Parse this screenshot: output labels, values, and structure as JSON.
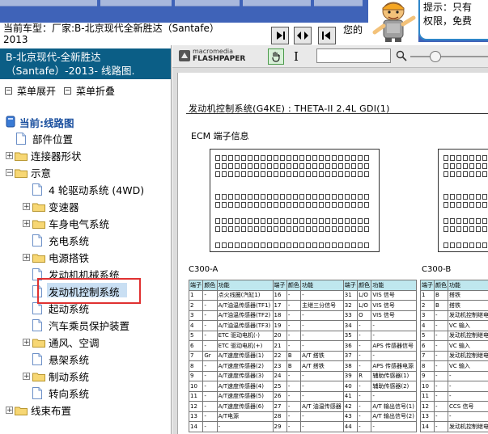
{
  "banner": {
    "tip_line1": "提示：只有",
    "tip_line2": "权限，免费"
  },
  "info": {
    "car_label": "当前车型：",
    "car_factory": "厂家:B-北京现代全新胜达（Santafe）",
    "car_year": "2013",
    "doc_title_partial": "您的"
  },
  "nav": {
    "buttons": [
      "▸|",
      "|◂▸|",
      "|◂"
    ]
  },
  "sidebar": {
    "header_line1": "B-北京现代-全新胜达",
    "header_line2": "（Santafe）-2013- 线路图.",
    "expand_label": "菜单展开",
    "collapse_label": "菜单折叠",
    "root_label": "当前:线路图",
    "items": [
      {
        "label": "部件位置",
        "type": "page",
        "level": 1
      },
      {
        "label": "连接器形状",
        "type": "folder",
        "level": 0,
        "toggle": "+"
      },
      {
        "label": "示意",
        "type": "folder",
        "level": 0,
        "toggle": "−"
      },
      {
        "label": "4 轮驱动系统 (4WD)",
        "type": "page",
        "level": 2
      },
      {
        "label": "变速器",
        "type": "folder",
        "level": 1,
        "toggle": "+"
      },
      {
        "label": "车身电气系统",
        "type": "folder",
        "level": 1,
        "toggle": "+"
      },
      {
        "label": "充电系统",
        "type": "page",
        "level": 2
      },
      {
        "label": "电源搭铁",
        "type": "folder",
        "level": 1,
        "toggle": "+"
      },
      {
        "label": "发动机机械系统",
        "type": "page",
        "level": 2
      },
      {
        "label": "发动机控制系统",
        "type": "page",
        "level": 2,
        "selected": true
      },
      {
        "label": "起动系统",
        "type": "page",
        "level": 2
      },
      {
        "label": "汽车乘员保护装置",
        "type": "page",
        "level": 2
      },
      {
        "label": "通风、空调",
        "type": "folder",
        "level": 1,
        "toggle": "+"
      },
      {
        "label": "悬架系统",
        "type": "page",
        "level": 2
      },
      {
        "label": "制动系统",
        "type": "folder",
        "level": 1,
        "toggle": "+"
      },
      {
        "label": "转向系统",
        "type": "page",
        "level": 2
      },
      {
        "label": "线束布置",
        "type": "folder",
        "level": 0,
        "toggle": "+"
      }
    ]
  },
  "viewer": {
    "brand_top": "macromedia",
    "brand_bottom": "FLASHPAPER",
    "search_value": "",
    "doc_heading": "发动机控制系统(G4KE) : THETA-II 2.4L GDI(1)",
    "doc_subheading": "ECM 端子信息",
    "connector_a_label": "C300-A",
    "connector_b_label": "C300-B",
    "table_a_header": [
      "端子",
      "颜色",
      "功能",
      "端子",
      "颜色",
      "功能",
      "端子",
      "颜色",
      "功能"
    ],
    "table_b_header": [
      "端子",
      "颜色",
      "功能"
    ],
    "table_a_rows": [
      [
        "1",
        "-",
        "点火线圈(汽缸1)",
        "16",
        "-",
        "-",
        "31",
        "L/O",
        "VIS 信号"
      ],
      [
        "2",
        "-",
        "A/T油温传感器(TF1)",
        "17",
        "-",
        "主继三分信号",
        "32",
        "L/O",
        "VIS 信号"
      ],
      [
        "3",
        "-",
        "A/T油温传感器(TF2)",
        "18",
        "-",
        "-",
        "33",
        "O",
        "VIS 信号"
      ],
      [
        "4",
        "-",
        "A/T油温传感器(TF3)",
        "19",
        "-",
        "-",
        "34",
        "-",
        "-"
      ],
      [
        "5",
        "-",
        "ETC 驱动电机(-)",
        "20",
        "-",
        "-",
        "35",
        "-",
        "-"
      ],
      [
        "6",
        "-",
        "ETC 驱动电机(+)",
        "21",
        "-",
        "-",
        "36",
        "-",
        "APS 传感器信号"
      ],
      [
        "7",
        "Gr",
        "A/T速度传感器(1)",
        "22",
        "B",
        "A/T 搭铁",
        "37",
        "-",
        "-"
      ],
      [
        "8",
        "-",
        "A/T速度传感器(2)",
        "23",
        "B",
        "A/T 搭铁",
        "38",
        "-",
        "APS 传感器电源"
      ],
      [
        "9",
        "-",
        "A/T速度传感器(3)",
        "24",
        "-",
        "-",
        "39",
        "R",
        "辅助传感器(1)"
      ],
      [
        "10",
        "-",
        "A/T速度传感器(4)",
        "25",
        "-",
        "-",
        "40",
        "-",
        "辅助传感器(2)"
      ],
      [
        "11",
        "-",
        "A/T速度传感器(5)",
        "26",
        "-",
        "-",
        "41",
        "-",
        "-"
      ],
      [
        "12",
        "-",
        "A/T速度传感器(6)",
        "27",
        "-",
        "A/T 油温传感器",
        "42",
        "-",
        "A/T 输出信号(1)"
      ],
      [
        "13",
        "-",
        "A/T电源",
        "28",
        "-",
        "-",
        "43",
        "-",
        "A/T 输出信号(2)"
      ],
      [
        "14",
        "-",
        "-",
        "29",
        "-",
        "-",
        "44",
        "-",
        "-"
      ]
    ],
    "table_b_rows": [
      [
        "1",
        "B",
        "搭铁"
      ],
      [
        "2",
        "B",
        "搭铁"
      ],
      [
        "3",
        "-",
        "发动机控制继电器"
      ],
      [
        "4",
        "-",
        "VC 输入"
      ],
      [
        "5",
        "-",
        "发动机控制继电器"
      ],
      [
        "6",
        "-",
        "VC 输入"
      ],
      [
        "7",
        "-",
        "发动机控制继电器"
      ],
      [
        "8",
        "-",
        "VC 输入"
      ],
      [
        "9",
        "-",
        "-"
      ],
      [
        "10",
        "-",
        "-"
      ],
      [
        "11",
        "-",
        "-"
      ],
      [
        "12",
        "-",
        "CCS 信号"
      ],
      [
        "13",
        "-",
        "-"
      ],
      [
        "14",
        "-",
        "发动机控制继电器"
      ]
    ]
  }
}
